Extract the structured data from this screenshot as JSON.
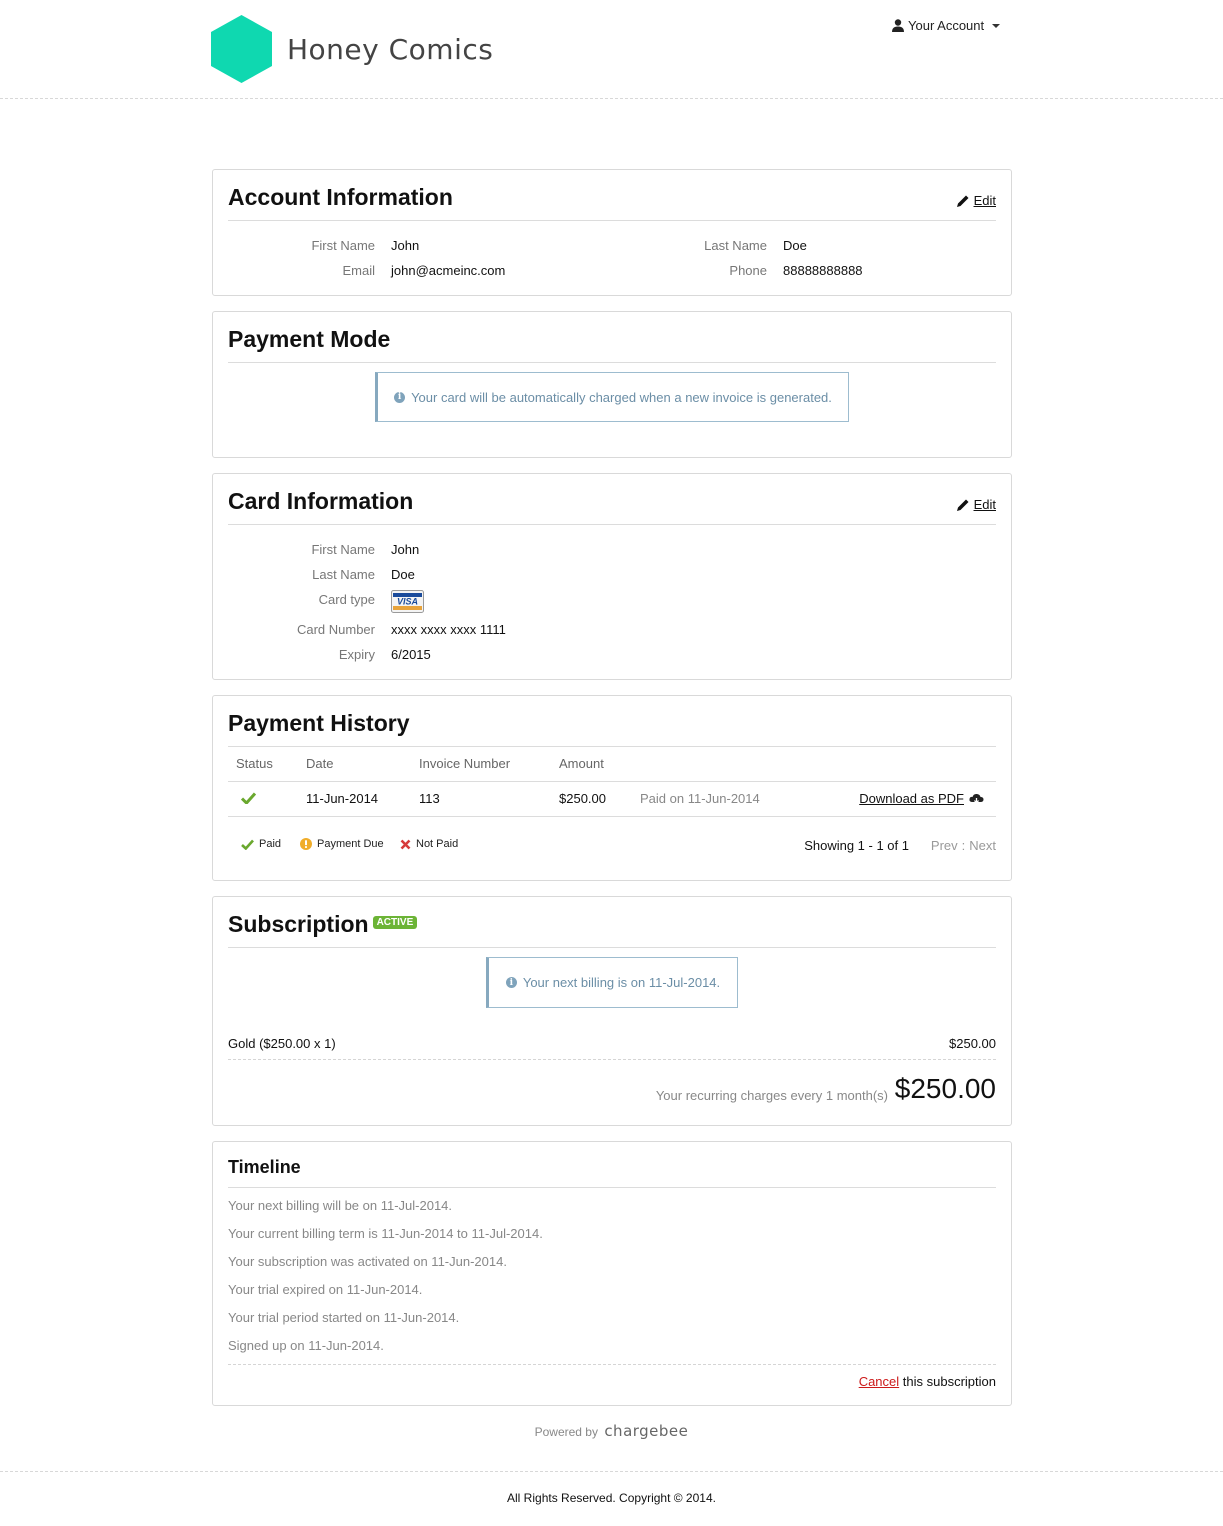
{
  "header": {
    "brand": "Honey Comics",
    "account_label": "Your Account",
    "logo_color": "#0fd8b0"
  },
  "account_info": {
    "title": "Account Information",
    "edit_label": "Edit",
    "first_name_label": "First Name",
    "first_name": "John",
    "last_name_label": "Last Name",
    "last_name": "Doe",
    "email_label": "Email",
    "email": "john@acmeinc.com",
    "phone_label": "Phone",
    "phone": "88888888888"
  },
  "payment_mode": {
    "title": "Payment Mode",
    "notice": "Your card will be automatically charged when a new invoice is generated."
  },
  "card_info": {
    "title": "Card Information",
    "edit_label": "Edit",
    "first_name_label": "First Name",
    "first_name": "John",
    "last_name_label": "Last Name",
    "last_name": "Doe",
    "card_type_label": "Card type",
    "card_type": "VISA",
    "card_number_label": "Card Number",
    "card_number": "xxxx xxxx xxxx 1111",
    "expiry_label": "Expiry",
    "expiry": "6/2015"
  },
  "payment_history": {
    "title": "Payment History",
    "columns": [
      "Status",
      "Date",
      "Invoice Number",
      "Amount"
    ],
    "rows": [
      {
        "status": "paid",
        "date": "11-Jun-2014",
        "invoice_number": "113",
        "amount": "$250.00",
        "paid_on": "Paid on 11-Jun-2014",
        "download_label": "Download as PDF"
      }
    ],
    "legend": {
      "paid": "Paid",
      "payment_due": "Payment Due",
      "not_paid": "Not Paid"
    },
    "showing": "Showing 1 - 1 of 1",
    "prev": "Prev",
    "separator": ":",
    "next": "Next"
  },
  "subscription": {
    "title": "Subscription",
    "status_badge": "ACTIVE",
    "notice": "Your next billing is on 11-Jul-2014.",
    "plan_label": "Gold ($250.00 x 1)",
    "plan_amount": "$250.00",
    "recurring_label": "Your recurring charges every 1 month(s)",
    "recurring_amount": "$250.00"
  },
  "timeline": {
    "title": "Timeline",
    "items": [
      "Your next billing will be on 11-Jul-2014.",
      "Your current billing term is 11-Jun-2014 to 11-Jul-2014.",
      "Your subscription was activated on 11-Jun-2014.",
      "Your trial expired on 11-Jun-2014.",
      "Your trial period started on 11-Jun-2014.",
      "Signed up on 11-Jun-2014."
    ],
    "cancel_label": "Cancel",
    "cancel_suffix": "this subscription"
  },
  "footer": {
    "powered_by": "Powered by",
    "powered_brand": "chargebee",
    "copyright": "All Rights Reserved. Copyright © 2014."
  }
}
